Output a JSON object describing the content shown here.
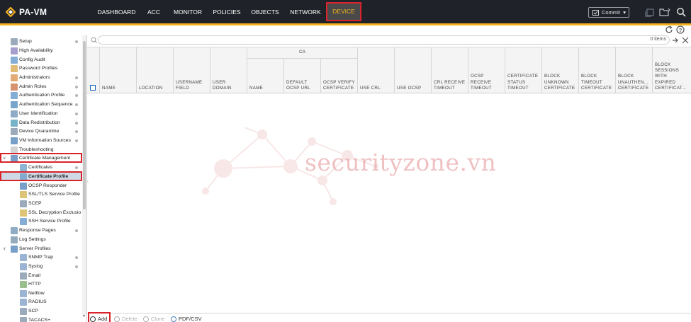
{
  "app": {
    "logo_text": "PA-VM"
  },
  "nav": {
    "tabs": [
      {
        "label": "DASHBOARD"
      },
      {
        "label": "ACC"
      },
      {
        "label": "MONITOR"
      },
      {
        "label": "POLICIES"
      },
      {
        "label": "OBJECTS"
      },
      {
        "label": "NETWORK"
      },
      {
        "label": "DEVICE",
        "active": true
      }
    ],
    "commit_label": "Commit"
  },
  "sidebar": {
    "items": [
      {
        "label": "Setup",
        "icon": "setup-icon",
        "dot": true
      },
      {
        "label": "High Availability",
        "icon": "ha-icon"
      },
      {
        "label": "Config Audit",
        "icon": "audit-icon"
      },
      {
        "label": "Password Profiles",
        "icon": "password-icon"
      },
      {
        "label": "Administrators",
        "icon": "admin-icon",
        "dot": true
      },
      {
        "label": "Admin Roles",
        "icon": "roles-icon",
        "dot": true
      },
      {
        "label": "Authentication Profile",
        "icon": "auth-profile-icon",
        "dot": true
      },
      {
        "label": "Authentication Sequence",
        "icon": "auth-seq-icon",
        "dot": true
      },
      {
        "label": "User Identification",
        "icon": "user-id-icon",
        "dot": true
      },
      {
        "label": "Data Redistribution",
        "icon": "redistribution-icon",
        "dot": true
      },
      {
        "label": "Device Quarantine",
        "icon": "quarantine-icon",
        "dot": true
      },
      {
        "label": "VM Information Sources",
        "icon": "vm-icon",
        "dot": true
      },
      {
        "label": "Troubleshooting",
        "icon": "troubleshoot-icon"
      },
      {
        "label": "Certificate Management",
        "icon": "cert-mgmt-icon",
        "expanded": true
      },
      {
        "label": "Certificates",
        "icon": "certificate-icon",
        "dot": true
      },
      {
        "label": "Certificate Profile",
        "icon": "cert-profile-icon",
        "selected": true
      },
      {
        "label": "OCSP Responder",
        "icon": "ocsp-icon"
      },
      {
        "label": "SSL/TLS Service Profile",
        "icon": "ssl-profile-icon"
      },
      {
        "label": "SCEP",
        "icon": "scep-icon"
      },
      {
        "label": "SSL Decryption Exclusio",
        "icon": "ssl-exclusion-icon"
      },
      {
        "label": "SSH Service Profile",
        "icon": "ssh-icon"
      },
      {
        "label": "Response Pages",
        "icon": "response-pages-icon",
        "dot": true
      },
      {
        "label": "Log Settings",
        "icon": "log-settings-icon"
      },
      {
        "label": "Server Profiles",
        "icon": "server-profiles-icon",
        "expanded": true
      },
      {
        "label": "SNMP Trap",
        "icon": "snmp-icon",
        "dot": true
      },
      {
        "label": "Syslog",
        "icon": "syslog-icon",
        "dot": true
      },
      {
        "label": "Email",
        "icon": "email-icon"
      },
      {
        "label": "HTTP",
        "icon": "http-icon"
      },
      {
        "label": "Netflow",
        "icon": "netflow-icon"
      },
      {
        "label": "RADIUS",
        "icon": "radius-icon"
      },
      {
        "label": "SCP",
        "icon": "scp-icon"
      },
      {
        "label": "TACACS+",
        "icon": "tacacs-icon"
      }
    ]
  },
  "filter": {
    "count_text": "0 items"
  },
  "table": {
    "group_header": "CA",
    "columns": [
      [
        "NAME"
      ],
      [
        "LOCATION"
      ],
      [
        "USERNAME",
        "FIELD"
      ],
      [
        "USER",
        "DOMAIN"
      ],
      [
        "NAME"
      ],
      [
        "DEFAULT",
        "OCSP URL"
      ],
      [
        "OCSP VERIFY",
        "CERTIFICATE"
      ],
      [
        "USE CRL"
      ],
      [
        "USE OCSP"
      ],
      [
        "CRL RECEIVE",
        "TIMEOUT"
      ],
      [
        "OCSP",
        "RECEIVE",
        "TIMEOUT"
      ],
      [
        "CERTIFICATE",
        "STATUS",
        "TIMEOUT"
      ],
      [
        "BLOCK",
        "UNKNOWN",
        "CERTIFICATE"
      ],
      [
        "BLOCK",
        "TIMEOUT",
        "CERTIFICATE"
      ],
      [
        "BLOCK",
        "UNAUTHEN...",
        "CERTIFICATE"
      ],
      [
        "BLOCK",
        "SESSIONS",
        "WITH",
        "EXPIRED",
        "CERTIFICAT..."
      ]
    ]
  },
  "watermark": {
    "text": "securityzone.vn"
  },
  "bottombar": {
    "add": "Add",
    "delete": "Delete",
    "clone": "Clone",
    "pdf": "PDF/CSV"
  },
  "colors": {
    "topbar": "#1f2329",
    "accent": "#f4b11d",
    "highlight": "#d8242a",
    "selection": "#cfd9e6"
  }
}
